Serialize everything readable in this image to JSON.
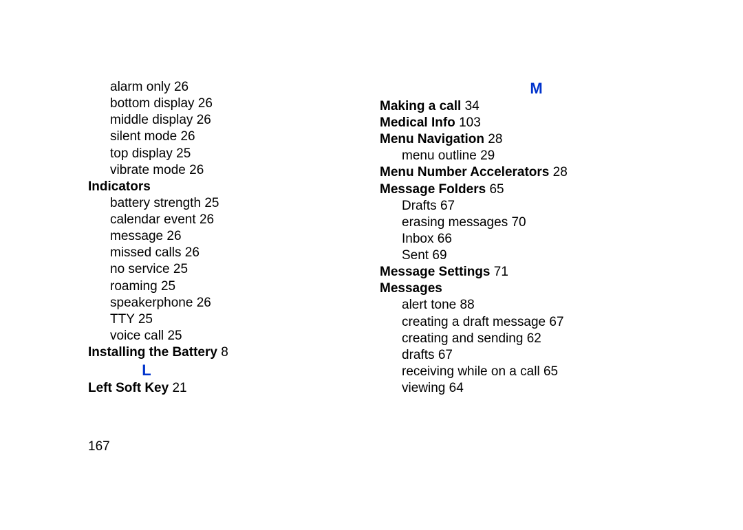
{
  "page_number": "167",
  "left": {
    "pre_sub": [
      {
        "text": "alarm only",
        "page": "26"
      },
      {
        "text": "bottom display",
        "page": "26"
      },
      {
        "text": "middle display",
        "page": "26"
      },
      {
        "text": "silent mode",
        "page": "26"
      },
      {
        "text": "top display",
        "page": "25"
      },
      {
        "text": "vibrate mode",
        "page": "26"
      }
    ],
    "indicators_label": "Indicators",
    "indicators_sub": [
      {
        "text": "battery strength",
        "page": "25"
      },
      {
        "text": "calendar event",
        "page": "26"
      },
      {
        "text": "message",
        "page": "26"
      },
      {
        "text": "missed calls",
        "page": "26"
      },
      {
        "text": "no service",
        "page": "25"
      },
      {
        "text": "roaming",
        "page": "25"
      },
      {
        "text": "speakerphone",
        "page": "26"
      },
      {
        "text": "TTY",
        "page": "25"
      },
      {
        "text": "voice call",
        "page": "25"
      }
    ],
    "installing_battery": {
      "label": "Installing the Battery",
      "page": "8"
    },
    "letter_L": "L",
    "left_soft_key": {
      "label": "Left Soft Key",
      "page": "21"
    }
  },
  "right": {
    "letter_M": "M",
    "making_a_call": {
      "label": "Making a call",
      "page": "34"
    },
    "medical_info": {
      "label": "Medical Info",
      "page": "103"
    },
    "menu_navigation": {
      "label": "Menu Navigation",
      "page": "28"
    },
    "menu_nav_sub": [
      {
        "text": "menu outline",
        "page": "29"
      }
    ],
    "menu_number_accel": {
      "label": "Menu Number Accelerators",
      "page": "28"
    },
    "message_folders": {
      "label": "Message Folders",
      "page": "65"
    },
    "message_folders_sub": [
      {
        "text": "Drafts",
        "page": "67"
      },
      {
        "text": "erasing messages",
        "page": "70"
      },
      {
        "text": "Inbox",
        "page": "66"
      },
      {
        "text": "Sent",
        "page": "69"
      }
    ],
    "message_settings": {
      "label": "Message Settings",
      "page": "71"
    },
    "messages_label": "Messages",
    "messages_sub": [
      {
        "text": "alert tone",
        "page": "88"
      },
      {
        "text": "creating a draft message",
        "page": "67"
      },
      {
        "text": "creating and sending",
        "page": "62"
      },
      {
        "text": "drafts",
        "page": "67"
      },
      {
        "text": "receiving while on a call",
        "page": "65"
      },
      {
        "text": "viewing",
        "page": "64"
      }
    ]
  }
}
